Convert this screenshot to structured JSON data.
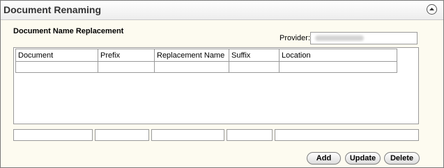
{
  "panel": {
    "title": "Document Renaming"
  },
  "section": {
    "title": "Document Name Replacement"
  },
  "provider": {
    "label": "Provider:",
    "value": ""
  },
  "table": {
    "columns": [
      "Document",
      "Prefix",
      "Replacement Name",
      "Suffix",
      "Location"
    ],
    "rows": []
  },
  "buttons": {
    "add": "Add",
    "update": "Update",
    "delete": "Delete"
  },
  "icons": {
    "collapse": "collapse-up-icon"
  }
}
